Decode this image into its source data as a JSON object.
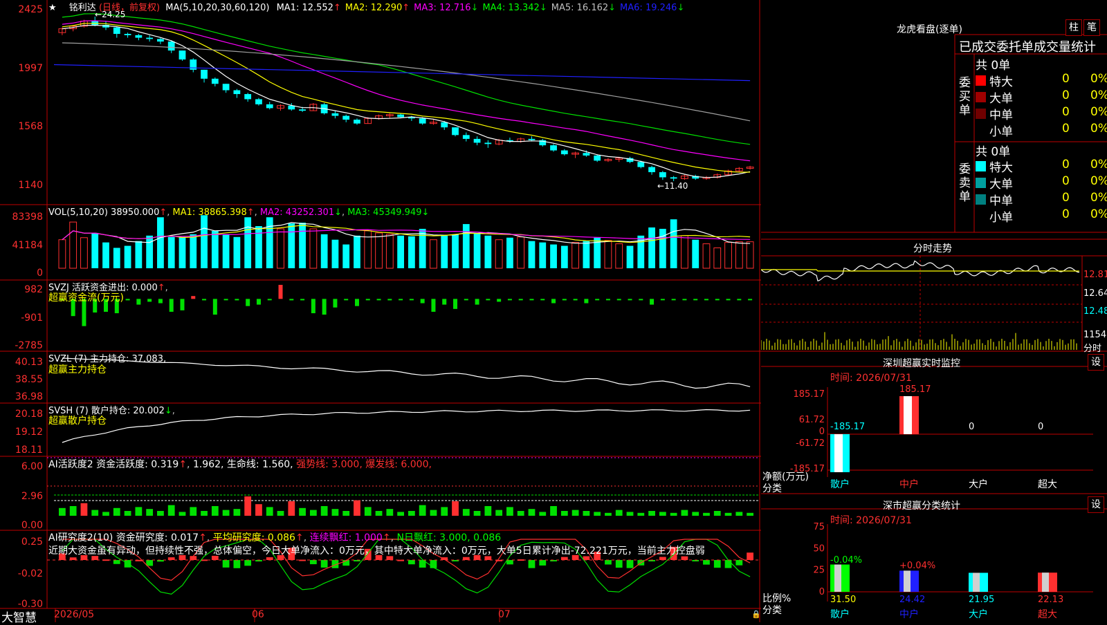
{
  "colors": {
    "up": "#ff3030",
    "down": "#00ffff",
    "green": "#00e000",
    "frame": "#c00000",
    "yellow": "#ffff00",
    "magenta": "#ff00ff",
    "white": "#ffffff",
    "gray": "#a0a0a0",
    "blue": "#2020ff"
  },
  "price_panel": {
    "star": "★",
    "name": "铭利达",
    "period": "(日线，前复权)",
    "ma_label": "MA(5,10,20,30,60,120)",
    "ma_values": [
      {
        "label": "MA1: 12.552",
        "arrow": "↑",
        "color": "#ffffff"
      },
      {
        "label": "MA2: 12.290",
        "arrow": "↑",
        "color": "#ffff00"
      },
      {
        "label": "MA3: 12.716",
        "arrow": "↓",
        "color": "#ff00ff"
      },
      {
        "label": "MA4: 13.342",
        "arrow": "↓",
        "color": "#00ff00"
      },
      {
        "label": "MA5: 16.162",
        "arrow": "↓",
        "color": "#c0c0c0"
      },
      {
        "label": "MA6: 19.246",
        "arrow": "↓",
        "color": "#2020ff"
      }
    ],
    "y_ticks": [
      "2425",
      "1997",
      "1568",
      "1140"
    ],
    "high_label": "24.25",
    "low_label": "11.40"
  },
  "volume_panel": {
    "header": "VOL(5,10,20)",
    "value": "38950.000",
    "ma1": "MA1: 38865.398",
    "ma2": "MA2: 43252.301",
    "ma3": "MA3: 45349.949",
    "y_ticks": [
      "83398",
      "41184",
      "0"
    ]
  },
  "svzj_panel": {
    "header": "SVZJ  活跃资金进出: 0.000",
    "subtitle": "超赢资金流(万元)",
    "y_ticks": [
      "982",
      "-901",
      "-2785"
    ]
  },
  "svzl_panel": {
    "header": "SVZL (7) 主力持仓: 37.083,",
    "subtitle": "超赢主力持仓",
    "y_ticks": [
      "40.13",
      "38.55",
      "36.98"
    ]
  },
  "svsh_panel": {
    "header": "SVSH (7) 散户持仓: 20.002",
    "subtitle": "超赢散户持仓",
    "y_ticks": [
      "20.18",
      "19.12",
      "18.11"
    ]
  },
  "ai2_panel": {
    "header": "AI活跃度2 资金活跃度: 0.319",
    "v2": "1.962,",
    "life": "生命线: 1.560,",
    "strong": "强势线: 3.000,",
    "burst": "爆发线: 6.000,",
    "y_ticks": [
      "6.00",
      "2.96",
      "0.00"
    ]
  },
  "ai_research_panel": {
    "header": "AI研究度2(10) 资金研究度: 0.017",
    "avg": "平均研究度: 0.086",
    "cont": "连续飘红: 1.000",
    "nday": "N日飘红: 3.000, 0.086",
    "note": "近期大资金虽有异动，但持续性不强，总体偏空，今日大单净流入：0万元，其中特大单净流入：0万元，大单5日累计净出-72.221万元，当前主力控盘弱",
    "y_ticks": [
      "0.25",
      "-0.02",
      "-0.30"
    ]
  },
  "x_axis": {
    "labels": [
      "2026/05",
      "06",
      "07"
    ],
    "brand": "大智慧"
  },
  "dragon": {
    "title": "龙虎看盘(逐单)",
    "tab1": "柱",
    "tab2": "笔",
    "section": "已成交委托单成交量统计",
    "buy_label": "委买单",
    "sell_label": "委卖单",
    "buy_total": "共 0单",
    "sell_total": "共 0单",
    "buy_rows": [
      {
        "label": "特大",
        "count": "0",
        "pct": "0%",
        "color": "#ff0000"
      },
      {
        "label": "大单",
        "count": "0",
        "pct": "0%",
        "color": "#a00000"
      },
      {
        "label": "中单",
        "count": "0",
        "pct": "0%",
        "color": "#700000"
      },
      {
        "label": "小单",
        "count": "0",
        "pct": "0%",
        "color": "#000000"
      }
    ],
    "sell_rows": [
      {
        "label": "特大",
        "count": "0",
        "pct": "0%",
        "color": "#00ffff"
      },
      {
        "label": "大单",
        "count": "0",
        "pct": "0%",
        "color": "#00a0a0"
      },
      {
        "label": "中单",
        "count": "0",
        "pct": "0%",
        "color": "#008080"
      },
      {
        "label": "小单",
        "count": "0",
        "pct": "0%",
        "color": "#000000"
      }
    ]
  },
  "intraday": {
    "title": "分时走势",
    "y_ticks": [
      "12.81",
      "12.64",
      "12.48"
    ],
    "vol_tick": "1154",
    "footer": "分时"
  },
  "sz_monitor": {
    "title": "深圳超赢实时监控",
    "set": "设",
    "time": "时间: 2026/07/31",
    "y_ticks": [
      "185.17",
      "61.72",
      "0",
      "-61.72",
      "-185.17"
    ],
    "y_caption": "净额(万元)",
    "x_caption": "分类",
    "categories": [
      "散户",
      "中户",
      "大户",
      "超大"
    ],
    "value_labels": [
      "-185.17",
      "185.17",
      "0",
      "0"
    ]
  },
  "sz_classify": {
    "title": "深市超赢分类统计",
    "set": "设",
    "time": "时间: 2026/07/31",
    "y_ticks": [
      "75",
      "50",
      "25",
      "0"
    ],
    "y_caption": "比例%",
    "x_caption": "分类",
    "categories": [
      "散户",
      "中户",
      "大户",
      "超大"
    ],
    "values": [
      "31.50",
      "24.42",
      "21.95",
      "22.13"
    ],
    "changes": [
      "-0.04%",
      "+0.04%"
    ]
  },
  "chart_data": [
    {
      "type": "candlestick",
      "title": "铭利达(日线，前复权)",
      "ylim": [
        11.4,
        24.25
      ],
      "y_ticks": [
        "2425",
        "1997",
        "1568",
        "1140"
      ],
      "x_labels": [
        "2026/05",
        "06",
        "07"
      ],
      "series": [
        {
          "name": "K",
          "ohlc": [
            [
              23.0,
              23.4,
              22.8,
              23.3
            ],
            [
              23.3,
              23.6,
              23.1,
              23.5
            ],
            [
              23.5,
              24.0,
              23.4,
              23.9
            ],
            [
              23.9,
              24.25,
              23.5,
              23.6
            ],
            [
              23.6,
              23.9,
              23.2,
              23.4
            ],
            [
              23.4,
              23.5,
              22.6,
              22.9
            ],
            [
              22.9,
              23.0,
              22.6,
              22.8
            ],
            [
              22.8,
              22.9,
              22.4,
              22.6
            ],
            [
              22.6,
              22.8,
              22.3,
              22.5
            ],
            [
              22.5,
              22.6,
              22.1,
              22.3
            ],
            [
              22.3,
              22.4,
              21.4,
              21.6
            ],
            [
              21.6,
              21.6,
              20.8,
              20.9
            ],
            [
              20.9,
              21.0,
              19.9,
              20.1
            ],
            [
              20.1,
              20.1,
              19.1,
              19.4
            ],
            [
              19.4,
              19.5,
              18.8,
              19.0
            ],
            [
              19.0,
              19.0,
              18.3,
              18.5
            ],
            [
              18.5,
              18.6,
              17.9,
              18.2
            ],
            [
              18.2,
              18.3,
              17.6,
              17.8
            ],
            [
              17.8,
              17.9,
              17.3,
              17.4
            ],
            [
              17.4,
              17.6,
              17.0,
              17.1
            ],
            [
              17.1,
              17.4,
              16.9,
              17.3
            ],
            [
              17.3,
              17.5,
              16.9,
              17.0
            ],
            [
              17.0,
              17.2,
              16.8,
              16.9
            ],
            [
              16.9,
              17.5,
              16.9,
              17.4
            ],
            [
              17.4,
              17.5,
              16.6,
              16.7
            ],
            [
              16.7,
              16.9,
              16.3,
              16.5
            ],
            [
              16.5,
              16.6,
              16.0,
              16.2
            ],
            [
              16.2,
              16.3,
              15.8,
              15.9
            ],
            [
              15.9,
              16.4,
              15.9,
              16.3
            ],
            [
              16.3,
              16.6,
              16.2,
              16.5
            ],
            [
              16.5,
              16.7,
              16.3,
              16.6
            ],
            [
              16.6,
              16.7,
              16.3,
              16.4
            ],
            [
              16.4,
              16.5,
              16.1,
              16.3
            ],
            [
              16.3,
              16.4,
              15.8,
              15.9
            ],
            [
              15.9,
              16.2,
              15.8,
              16.0
            ],
            [
              16.0,
              16.1,
              15.4,
              15.6
            ],
            [
              15.6,
              15.6,
              14.9,
              15.0
            ],
            [
              15.0,
              15.2,
              14.5,
              14.7
            ],
            [
              14.7,
              14.9,
              14.2,
              14.4
            ],
            [
              14.4,
              14.6,
              14.0,
              14.3
            ],
            [
              14.3,
              14.7,
              14.2,
              14.6
            ],
            [
              14.6,
              14.8,
              14.4,
              14.5
            ],
            [
              14.5,
              14.8,
              14.4,
              14.7
            ],
            [
              14.7,
              14.9,
              14.5,
              14.6
            ],
            [
              14.6,
              14.7,
              14.1,
              14.2
            ],
            [
              14.2,
              14.3,
              13.7,
              13.8
            ],
            [
              13.8,
              13.9,
              13.4,
              13.5
            ],
            [
              13.5,
              13.7,
              13.2,
              13.6
            ],
            [
              13.6,
              13.8,
              13.3,
              13.4
            ],
            [
              13.4,
              13.5,
              12.9,
              13.0
            ],
            [
              13.0,
              13.2,
              12.9,
              13.1
            ],
            [
              13.1,
              13.3,
              12.9,
              13.2
            ],
            [
              13.2,
              13.3,
              12.8,
              12.9
            ],
            [
              12.9,
              13.0,
              12.4,
              12.5
            ],
            [
              12.5,
              12.6,
              11.9,
              12.1
            ],
            [
              12.1,
              12.2,
              11.5,
              11.7
            ],
            [
              11.7,
              11.8,
              11.4,
              11.6
            ],
            [
              11.6,
              11.9,
              11.5,
              11.8
            ],
            [
              11.8,
              11.9,
              11.5,
              11.6
            ],
            [
              11.6,
              11.8,
              11.5,
              11.7
            ],
            [
              11.7,
              12.0,
              11.6,
              11.9
            ],
            [
              11.9,
              12.3,
              11.8,
              12.2
            ],
            [
              12.2,
              12.5,
              12.1,
              12.4
            ],
            [
              12.4,
              12.6,
              12.3,
              12.5
            ]
          ]
        },
        {
          "name": "MA6",
          "values": [
            20.5,
            19.25
          ]
        },
        {
          "name": "MA5",
          "values": [
            22.2,
            16.2
          ]
        }
      ]
    },
    {
      "type": "bar",
      "title": "VOL(5,10,20)",
      "ylim": [
        0,
        83398
      ],
      "values": [
        42000,
        68000,
        45000,
        52000,
        38000,
        30000,
        33000,
        40000,
        48000,
        75000,
        46000,
        46000,
        50000,
        78000,
        55000,
        50000,
        46000,
        75000,
        62000,
        75000,
        58000,
        66000,
        67000,
        58000,
        50000,
        42000,
        35000,
        48000,
        55000,
        52000,
        50000,
        48000,
        47000,
        58000,
        42000,
        48000,
        50000,
        65000,
        52000,
        48000,
        42000,
        45000,
        46000,
        40000,
        38000,
        35000,
        33000,
        38000,
        40000,
        45000,
        41000,
        36000,
        33000,
        48000,
        60000,
        58000,
        72000,
        48000,
        42000,
        36000,
        30000,
        38000,
        39000,
        39000
      ]
    },
    {
      "type": "bar",
      "title": "超赢资金流(万元)",
      "ylim": [
        -2785,
        982
      ],
      "values": [
        -100,
        -1200,
        -1900,
        -950,
        -900,
        -1000,
        -100,
        -400,
        -200,
        -300,
        -900,
        -800,
        200,
        -100,
        -1100,
        -50,
        -100,
        -500,
        -400,
        -50,
        982,
        -100,
        -100,
        -1000,
        -1100,
        -600,
        -50,
        -500,
        -50,
        -50,
        -100,
        -50,
        -50,
        -300,
        -900,
        -400,
        -700,
        -50,
        -400,
        -50,
        -200,
        -50,
        -50,
        -50,
        -50,
        -300,
        -100,
        -100,
        -300,
        -50,
        -50,
        -50,
        -50,
        -50,
        -400,
        -50,
        -50,
        -50,
        -50,
        -50,
        -50,
        -50,
        -50,
        -50
      ]
    },
    {
      "type": "bar",
      "title": "AI活跃度2",
      "ylim": [
        0,
        6.0
      ],
      "values": [
        0.8,
        1.0,
        1.3,
        0.6,
        0.4,
        0.8,
        0.5,
        0.9,
        0.7,
        0.5,
        1.1,
        0.4,
        0.9,
        0.5,
        1.0,
        0.6,
        0.7,
        2.0,
        1.2,
        0.9,
        0.5,
        1.5,
        0.8,
        0.6,
        1.0,
        0.7,
        0.5,
        1.6,
        0.9,
        0.5,
        0.7,
        0.4,
        0.5,
        1.1,
        0.6,
        0.9,
        1.5,
        0.7,
        0.5,
        1.0,
        0.6,
        0.9,
        0.5,
        0.7,
        0.4,
        1.0,
        0.5,
        0.6,
        0.5,
        0.4,
        0.3,
        0.6,
        0.4,
        0.3,
        0.5,
        0.4,
        0.3,
        0.6,
        0.4,
        0.3,
        0.5,
        0.3,
        0.4,
        0.3
      ]
    },
    {
      "type": "bar",
      "title": "深圳超赢实时监控",
      "categories": [
        "散户",
        "中户",
        "大户",
        "超大"
      ],
      "values": [
        -185.17,
        185.17,
        0,
        0
      ],
      "ylim": [
        -185.17,
        185.17
      ],
      "ylabel": "净额(万元)",
      "xlabel": "分类"
    },
    {
      "type": "bar",
      "title": "深市超赢分类统计",
      "categories": [
        "散户",
        "中户",
        "大户",
        "超大"
      ],
      "values": [
        31.5,
        24.42,
        21.95,
        22.13
      ],
      "ylim": [
        0,
        75
      ],
      "ylabel": "比例%",
      "xlabel": "分类"
    }
  ]
}
